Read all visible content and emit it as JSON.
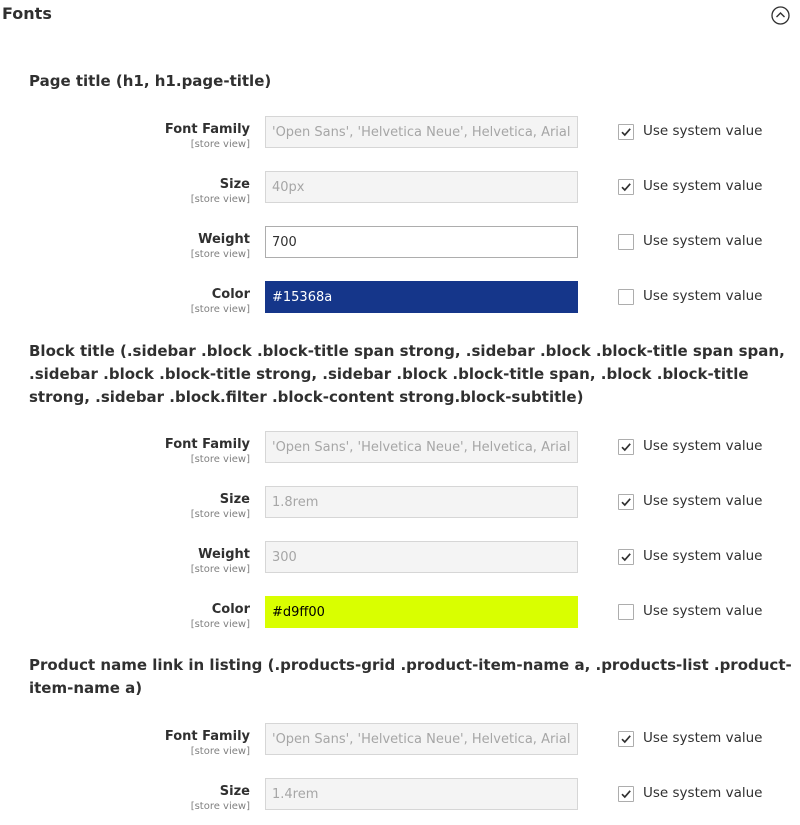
{
  "section": {
    "title": "Fonts",
    "collapse_icon": "chevron-up-circle-icon"
  },
  "groups": [
    {
      "title": "Page title (h1, h1.page-title)",
      "fields": [
        {
          "label": "Font Family",
          "scope": "[store view]",
          "value": "'Open Sans', 'Helvetica Neue', Helvetica, Arial, sans-serif",
          "disabled": true,
          "use_system": true,
          "use_system_label": "Use system value"
        },
        {
          "label": "Size",
          "scope": "[store view]",
          "value": "40px",
          "disabled": true,
          "use_system": true,
          "use_system_label": "Use system value"
        },
        {
          "label": "Weight",
          "scope": "[store view]",
          "value": "700",
          "disabled": false,
          "use_system": false,
          "use_system_label": "Use system value"
        },
        {
          "label": "Color",
          "scope": "[store view]",
          "value": "#15368a",
          "disabled": false,
          "swatch": "#15368a",
          "text_color": "#ffffff",
          "use_system": false,
          "use_system_label": "Use system value"
        }
      ]
    },
    {
      "title": "Block title (.sidebar .block .block-title span strong, .sidebar .block .block-title span span, .sidebar .block .block-title strong, .sidebar .block .block-title span, .block .block-title strong, .sidebar .block.filter .block-content strong.block-subtitle)",
      "fields": [
        {
          "label": "Font Family",
          "scope": "[store view]",
          "value": "'Open Sans', 'Helvetica Neue', Helvetica, Arial, sans-serif",
          "disabled": true,
          "use_system": true,
          "use_system_label": "Use system value"
        },
        {
          "label": "Size",
          "scope": "[store view]",
          "value": "1.8rem",
          "disabled": true,
          "use_system": true,
          "use_system_label": "Use system value"
        },
        {
          "label": "Weight",
          "scope": "[store view]",
          "value": "300",
          "disabled": true,
          "use_system": true,
          "use_system_label": "Use system value"
        },
        {
          "label": "Color",
          "scope": "[store view]",
          "value": "#d9ff00",
          "disabled": false,
          "swatch": "#d9ff00",
          "text_color": "#000000",
          "use_system": false,
          "use_system_label": "Use system value"
        }
      ]
    },
    {
      "title": "Product name link in listing (.products-grid .product-item-name a, .products-list .product-item-name a)",
      "fields": [
        {
          "label": "Font Family",
          "scope": "[store view]",
          "value": "'Open Sans', 'Helvetica Neue', Helvetica, Arial, sans-serif",
          "disabled": true,
          "use_system": true,
          "use_system_label": "Use system value"
        },
        {
          "label": "Size",
          "scope": "[store view]",
          "value": "1.4rem",
          "disabled": true,
          "use_system": true,
          "use_system_label": "Use system value"
        }
      ]
    }
  ]
}
